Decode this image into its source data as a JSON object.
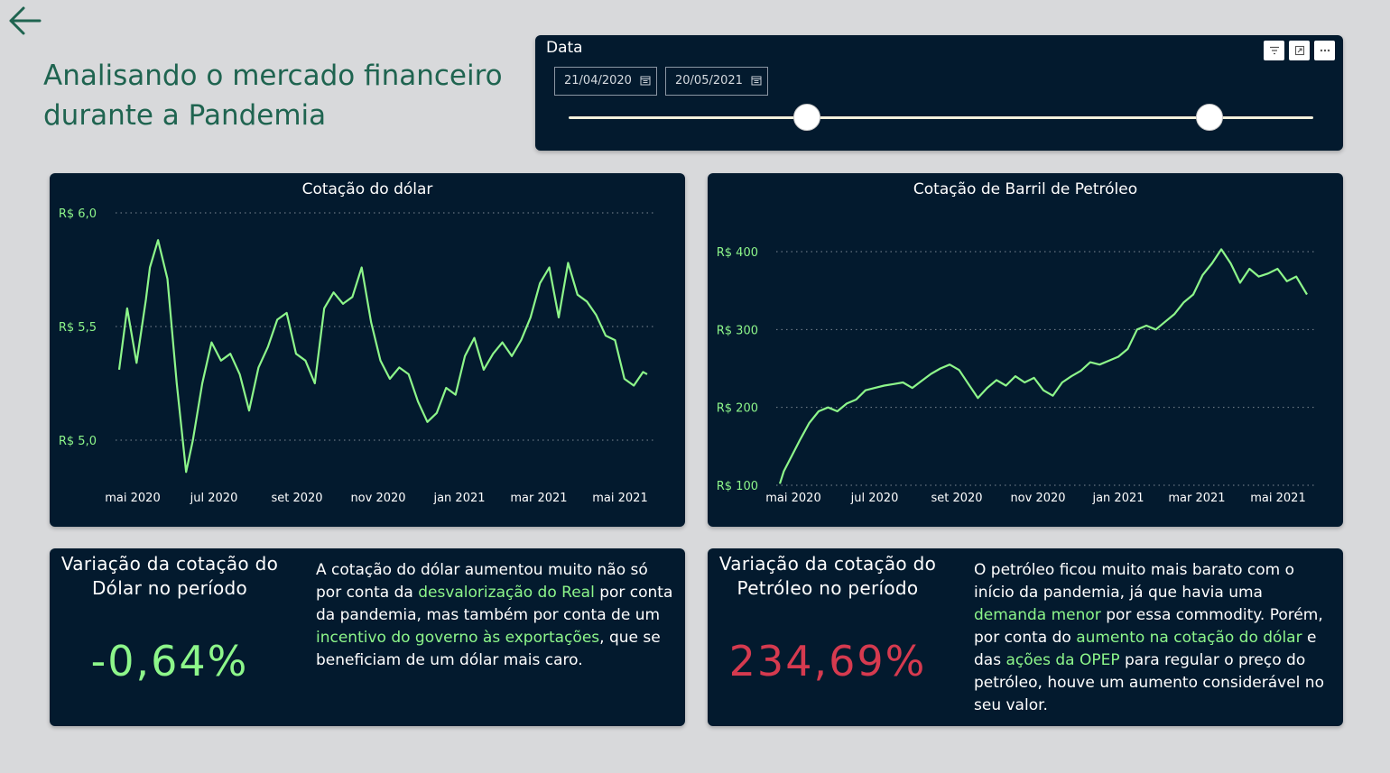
{
  "header": {
    "title": "Analisando o mercado financeiro durante a Pandemia"
  },
  "date_slicer": {
    "label": "Data",
    "start_date": "21/04/2020",
    "end_date": "20/05/2021",
    "start_fraction": 0.32,
    "end_fraction": 0.86
  },
  "colors": {
    "background": "#d8d9db",
    "card": "#031a2e",
    "title": "#1f6450",
    "line": "#8df68a",
    "positive": "#8df68a",
    "negative": "#d63a4f"
  },
  "icons": [
    "back-arrow-icon",
    "filter-icon",
    "focus-mode-icon",
    "more-options-icon",
    "calendar-icon"
  ],
  "chart_data": [
    {
      "type": "line",
      "title": "Cotação do dólar",
      "yticks": [
        "R$ 5,0",
        "R$ 5,5",
        "R$ 6,0"
      ],
      "ylim": [
        5.0,
        6.0
      ],
      "xticks": [
        "mai 2020",
        "jul 2020",
        "set 2020",
        "nov 2020",
        "jan 2021",
        "mar 2021",
        "mai 2021"
      ],
      "grid": true,
      "x": [
        "2020-04-21",
        "2020-04-27",
        "2020-05-04",
        "2020-05-11",
        "2020-05-14",
        "2020-05-20",
        "2020-05-27",
        "2020-06-03",
        "2020-06-10",
        "2020-06-15",
        "2020-06-22",
        "2020-06-29",
        "2020-07-06",
        "2020-07-13",
        "2020-07-20",
        "2020-07-27",
        "2020-08-03",
        "2020-08-10",
        "2020-08-17",
        "2020-08-24",
        "2020-08-31",
        "2020-09-07",
        "2020-09-14",
        "2020-09-21",
        "2020-09-28",
        "2020-10-05",
        "2020-10-12",
        "2020-10-19",
        "2020-10-26",
        "2020-11-02",
        "2020-11-09",
        "2020-11-16",
        "2020-11-23",
        "2020-11-30",
        "2020-12-07",
        "2020-12-14",
        "2020-12-21",
        "2020-12-28",
        "2021-01-04",
        "2021-01-11",
        "2021-01-18",
        "2021-01-25",
        "2021-02-01",
        "2021-02-08",
        "2021-02-15",
        "2021-02-22",
        "2021-03-01",
        "2021-03-08",
        "2021-03-15",
        "2021-03-22",
        "2021-03-29",
        "2021-04-05",
        "2021-04-12",
        "2021-04-19",
        "2021-04-26",
        "2021-05-03",
        "2021-05-10",
        "2021-05-17",
        "2021-05-20"
      ],
      "series": [
        {
          "values": [
            5.31,
            5.58,
            5.34,
            5.62,
            5.76,
            5.88,
            5.71,
            5.25,
            4.86,
            5.0,
            5.25,
            5.43,
            5.35,
            5.38,
            5.29,
            5.13,
            5.32,
            5.41,
            5.53,
            5.56,
            5.38,
            5.35,
            5.25,
            5.58,
            5.65,
            5.6,
            5.63,
            5.76,
            5.52,
            5.35,
            5.27,
            5.32,
            5.29,
            5.17,
            5.08,
            5.12,
            5.23,
            5.2,
            5.37,
            5.45,
            5.31,
            5.38,
            5.43,
            5.37,
            5.44,
            5.54,
            5.69,
            5.76,
            5.54,
            5.78,
            5.64,
            5.61,
            5.55,
            5.46,
            5.44,
            5.27,
            5.24,
            5.3,
            5.29
          ]
        }
      ]
    },
    {
      "type": "line",
      "title": "Cotação de Barril de Petróleo",
      "yticks": [
        "R$ 100",
        "R$ 200",
        "R$ 300",
        "R$ 400"
      ],
      "ylim": [
        100,
        400
      ],
      "xticks": [
        "mai 2020",
        "jul 2020",
        "set 2020",
        "nov 2020",
        "jan 2021",
        "mar 2021",
        "mai 2021"
      ],
      "grid": true,
      "x": [
        "2020-04-21",
        "2020-04-24",
        "2020-04-30",
        "2020-05-06",
        "2020-05-13",
        "2020-05-20",
        "2020-05-27",
        "2020-06-03",
        "2020-06-10",
        "2020-06-17",
        "2020-06-24",
        "2020-07-01",
        "2020-07-08",
        "2020-07-15",
        "2020-07-22",
        "2020-07-29",
        "2020-08-05",
        "2020-08-12",
        "2020-08-19",
        "2020-08-26",
        "2020-09-02",
        "2020-09-09",
        "2020-09-16",
        "2020-09-23",
        "2020-09-30",
        "2020-10-07",
        "2020-10-14",
        "2020-10-21",
        "2020-10-28",
        "2020-11-04",
        "2020-11-11",
        "2020-11-18",
        "2020-11-25",
        "2020-12-02",
        "2020-12-09",
        "2020-12-16",
        "2020-12-23",
        "2020-12-30",
        "2021-01-06",
        "2021-01-13",
        "2021-01-20",
        "2021-01-27",
        "2021-02-03",
        "2021-02-10",
        "2021-02-17",
        "2021-02-24",
        "2021-03-03",
        "2021-03-10",
        "2021-03-17",
        "2021-03-24",
        "2021-03-31",
        "2021-04-07",
        "2021-04-14",
        "2021-04-21",
        "2021-04-28",
        "2021-05-05",
        "2021-05-12",
        "2021-05-20"
      ],
      "series": [
        {
          "values": [
            102,
            118,
            138,
            158,
            180,
            195,
            200,
            195,
            205,
            210,
            222,
            225,
            228,
            230,
            232,
            225,
            234,
            243,
            250,
            255,
            248,
            230,
            212,
            225,
            235,
            228,
            240,
            232,
            238,
            222,
            215,
            232,
            240,
            247,
            258,
            255,
            260,
            265,
            275,
            300,
            305,
            300,
            310,
            320,
            335,
            345,
            370,
            385,
            403,
            385,
            360,
            378,
            368,
            372,
            378,
            362,
            368,
            345
          ]
        }
      ]
    }
  ],
  "kpis": {
    "dollar": {
      "title": "Variação da cotação do Dólar no período",
      "value": "-0,64%",
      "description": [
        {
          "text": "A cotação do dólar aumentou muito não só por conta da ",
          "highlight": false
        },
        {
          "text": "desvalorização do Real",
          "highlight": true
        },
        {
          "text": " por conta da pandemia, mas também por conta de um ",
          "highlight": false
        },
        {
          "text": "incentivo do governo às exportações",
          "highlight": true
        },
        {
          "text": ", que se beneficiam de um dólar mais caro.",
          "highlight": false
        }
      ]
    },
    "oil": {
      "title": "Variação da cotação do Petróleo no período",
      "value": "234,69%",
      "description": [
        {
          "text": "O petróleo ficou muito mais barato com o início da pandemia, já que havia uma ",
          "highlight": false
        },
        {
          "text": "demanda menor",
          "highlight": true
        },
        {
          "text": " por essa commodity. Porém, por conta do ",
          "highlight": false
        },
        {
          "text": "aumento na cotação do dólar",
          "highlight": true
        },
        {
          "text": " e das ",
          "highlight": false
        },
        {
          "text": "ações da OPEP",
          "highlight": true
        },
        {
          "text": " para regular o preço do petróleo, houve um aumento considerável no seu valor.",
          "highlight": false
        }
      ]
    }
  }
}
